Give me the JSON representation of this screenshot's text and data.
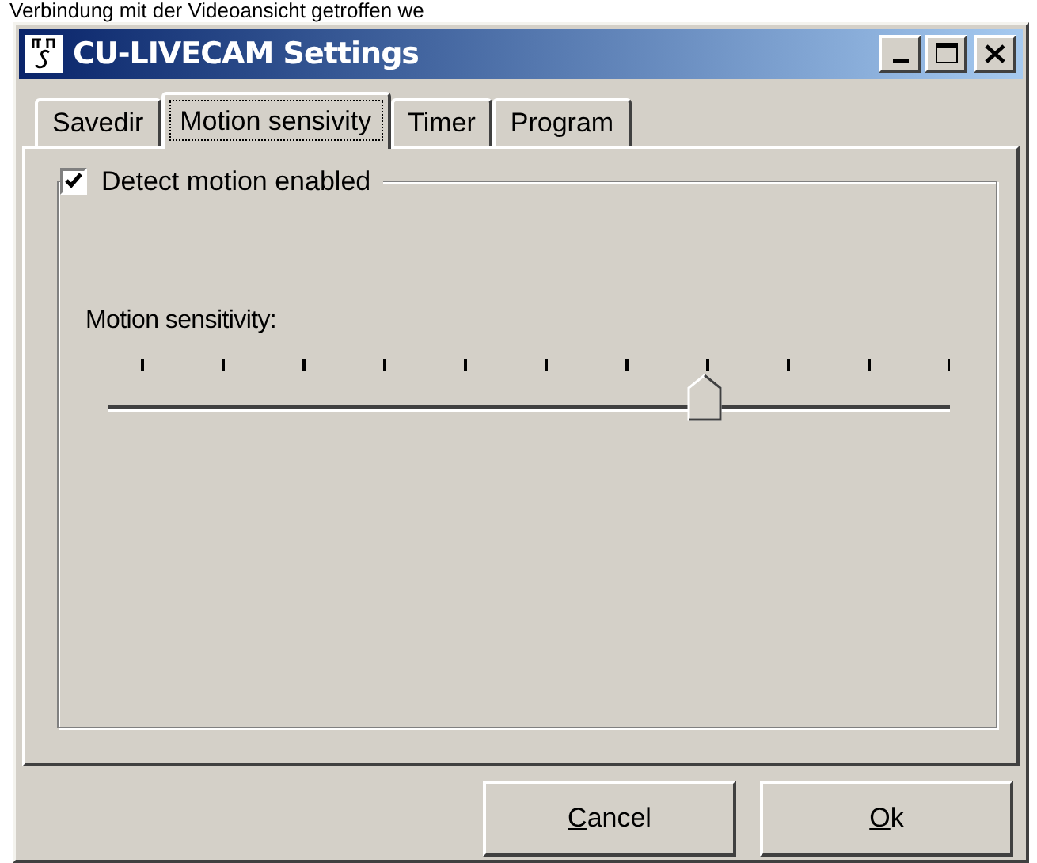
{
  "background_text": "Verbindung mit der Videoansicht getroffen we",
  "window": {
    "title": "CU-LIVECAM Settings"
  },
  "tabs": [
    {
      "label": "Savedir",
      "selected": false
    },
    {
      "label": "Motion sensivity",
      "selected": true
    },
    {
      "label": "Timer",
      "selected": false
    },
    {
      "label": "Program",
      "selected": false
    }
  ],
  "detect_motion": {
    "label": "Detect motion enabled",
    "checked": true
  },
  "sensitivity": {
    "label": "Motion sensitivity:",
    "level": 0.7
  },
  "buttons": [
    "Cancel",
    "Ok"
  ]
}
